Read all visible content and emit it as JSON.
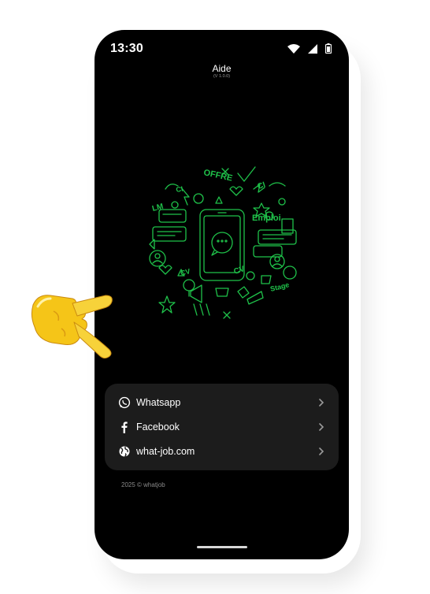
{
  "status_bar": {
    "time": "13:30",
    "icons": [
      "wifi-icon",
      "cellular-signal-icon",
      "battery-icon"
    ]
  },
  "header": {
    "title": "Aide",
    "version": "(V 1.0.0)"
  },
  "illustration": {
    "name": "job-doodle-phone-illustration",
    "words": [
      "OFFRE",
      "CV",
      "LM",
      "Emploi",
      "Stage"
    ],
    "accent_color": "#1fc24a"
  },
  "links": [
    {
      "label": "Whatsapp",
      "icon": "whatsapp-icon"
    },
    {
      "label": "Facebook",
      "icon": "facebook-icon"
    },
    {
      "label": "what-job.com",
      "icon": "globe-icon"
    }
  ],
  "footer": {
    "year": "2025",
    "copyright": "© whatjob"
  },
  "decoration": {
    "hand": "pointing-hand-emoji"
  },
  "colors": {
    "background": "#000000",
    "card": "#1c1c1c",
    "text": "#ffffff",
    "muted": "#8a8a8a",
    "doodle": "#1fc24a",
    "hand": "#f5c518"
  }
}
